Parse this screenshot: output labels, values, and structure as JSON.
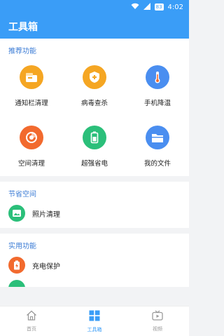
{
  "status": {
    "time": "4:02",
    "battery": "83"
  },
  "header": {
    "title": "工具箱"
  },
  "sections": {
    "recommended": {
      "title": "推荐功能",
      "items": [
        {
          "label": "通知栏清理",
          "icon": "notification-clean-icon",
          "color": "#f5a623"
        },
        {
          "label": "病毒查杀",
          "icon": "virus-shield-icon",
          "color": "#f5a623"
        },
        {
          "label": "手机降温",
          "icon": "thermometer-icon",
          "color": "#4a8ef0"
        },
        {
          "label": "空间清理",
          "icon": "storage-clean-icon",
          "color": "#f26a2e"
        },
        {
          "label": "超强省电",
          "icon": "battery-icon",
          "color": "#2bbf7a"
        },
        {
          "label": "我的文件",
          "icon": "folder-icon",
          "color": "#4a8ef0"
        }
      ]
    },
    "space": {
      "title": "节省空间",
      "items": [
        {
          "label": "照片清理",
          "icon": "photo-icon",
          "color": "#2bbf7a"
        }
      ]
    },
    "utility": {
      "title": "实用功能",
      "items": [
        {
          "label": "充电保护",
          "icon": "charging-protect-icon",
          "color": "#f26a2e"
        }
      ]
    }
  },
  "tabbar": {
    "home": "首页",
    "toolbox": "工具箱",
    "video": "视频"
  },
  "colors": {
    "primary": "#3a9df7",
    "section_title": "#3a7bd5"
  }
}
